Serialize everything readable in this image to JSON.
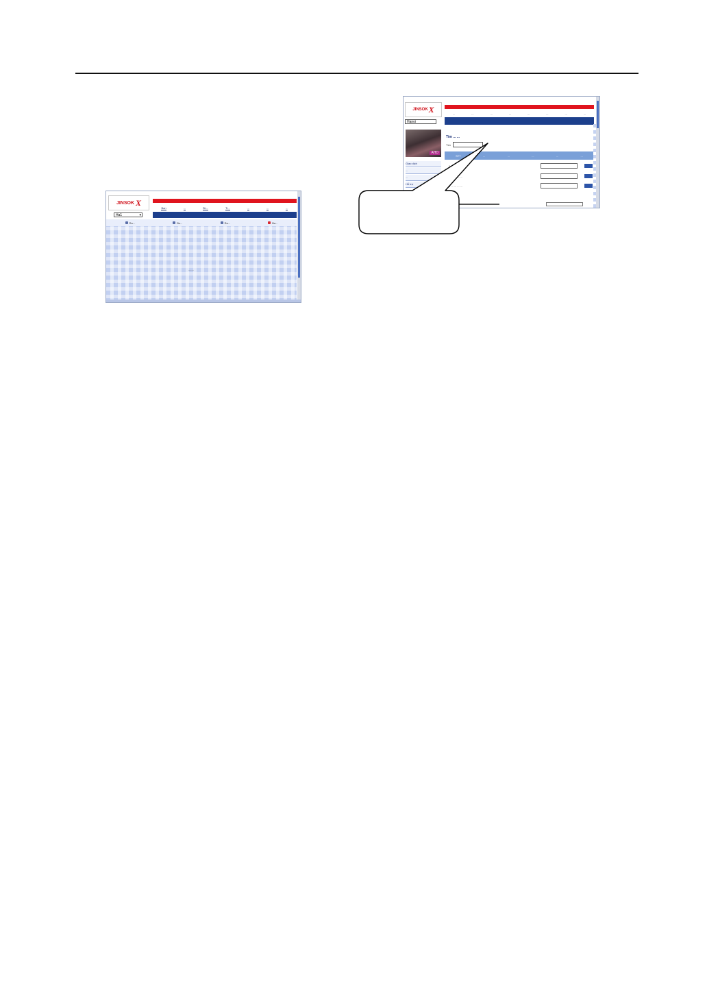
{
  "page": {
    "rule": "header-rule"
  },
  "screenshot1": {
    "logo_text": "JINSOK",
    "logo_x": "X",
    "select_value": "Ha1",
    "nav_items": [
      "Ban",
      "...",
      "Sh...",
      "Ti...",
      "...",
      "...",
      "..."
    ],
    "tabs": [
      "Ra...",
      "Bo...",
      "Ra...",
      "Ba..."
    ],
    "center_text": "......."
  },
  "screenshot2": {
    "logo_text": "JINSOK",
    "logo_x": "X",
    "select_value": "Hanoi",
    "nav_items": [
      "...",
      "...",
      "...",
      "...",
      "...",
      "...",
      "...",
      "..."
    ],
    "photo_tag": "AHD",
    "side_items": [
      "Giao dịch",
      "...",
      "...",
      "Hỗ trợ"
    ],
    "heading": "Tìm ... ...",
    "combo_label": "Tìm",
    "table_headers": [
      "STT",
      "...",
      "...",
      "...",
      "...",
      "..."
    ],
    "rows": [
      {
        "text": "1  ...  ...  ...  ..."
      },
      {
        "text": "2  ...  ...  ...  ..."
      },
      {
        "text": "3  ...  ...  ...  ..."
      }
    ]
  },
  "colors": {
    "brand_red": "#e0141e",
    "nav_blue": "#1c3f8c",
    "table_head": "#7aa0d8"
  }
}
